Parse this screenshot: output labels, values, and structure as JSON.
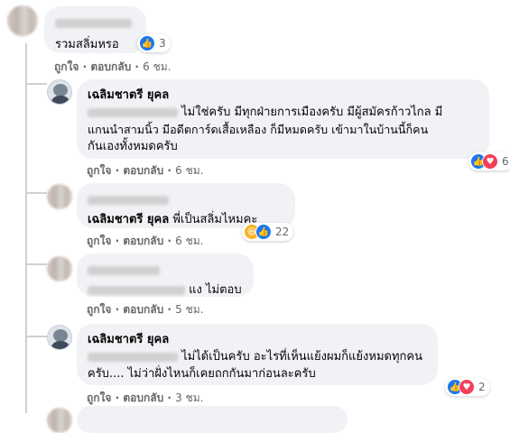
{
  "comments": [
    {
      "text": "รวมสลิ่มหรอ",
      "reaction_count": "3",
      "like_label": "ถูกใจ",
      "reply_label": "ตอบกลับ",
      "time": "6 ชม."
    },
    {
      "author": "เฉลิมชาตรี ยุคล",
      "text": "ไม่ใช่ครับ มีทุกฝ่ายการเมืองครับ มีผู้สมัครก้าวไกล มีแกนนำสามนิ้ว มีอดีตการ์ดเสื้อเหลือง ก็มีหมดครับ เข้ามาในบ้านนี้ก็คนกันเองทั้งหมดครับ",
      "line1": "ไม่ใช่ครับ มีทุกฝ่ายการเมืองครับ มีผู้สมัครก้าวไกล มี",
      "line2": "แกนนำสามนิ้ว มีอดีตการ์ดเสื้อเหลือง ก็มีหมดครับ เข้ามาในบ้านนี้ก็คน",
      "line3": "กันเองทั้งหมดครับ",
      "reaction_count": "6",
      "like_label": "ถูกใจ",
      "reply_label": "ตอบกลับ",
      "time": "6 ชม."
    },
    {
      "mention": "เฉลิมชาตรี ยุคล",
      "text": "พี่เป็นสลิ่มไหมคะ",
      "reaction_count": "22",
      "like_label": "ถูกใจ",
      "reply_label": "ตอบกลับ",
      "time": "6 ชม."
    },
    {
      "text": "แง ไม่ตอบ",
      "like_label": "ถูกใจ",
      "reply_label": "ตอบกลับ",
      "time": "5 ชม."
    },
    {
      "author": "เฉลิมชาตรี ยุคล",
      "line1": "ไม่ได้เป็นครับ อะไรที่เห็นแย้งผมก็แย้งหมดทุกคน",
      "line2": "ครับ.... ไม่ว่าฝั่งไหนก็เคยถกกันมาก่อนละครับ",
      "reaction_count": "2",
      "like_label": "ถูกใจ",
      "reply_label": "ตอบกลับ",
      "time": "3 ชม."
    }
  ],
  "separator": "·",
  "icons": {
    "like": "like-icon",
    "love": "love-icon",
    "haha": "haha-icon"
  },
  "colors": {
    "bubble": "#f0f2f5",
    "like": "#1877f2",
    "love": "#f33e58",
    "haha": "#f7b125",
    "meta": "#65676b"
  }
}
